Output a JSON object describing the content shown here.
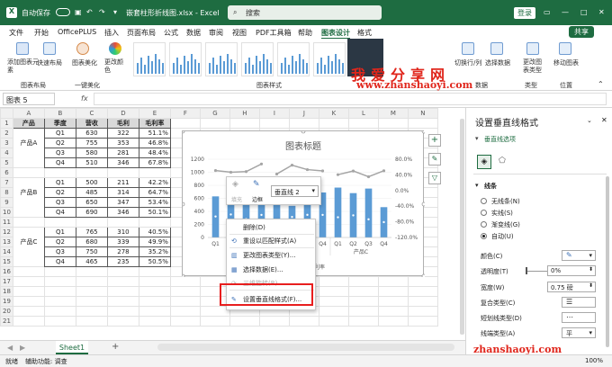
{
  "titlebar": {
    "autosave": "自动保存",
    "filename": "嵌套柱形折线图.xlsx - Excel",
    "search_placeholder": "搜索",
    "login": "登录",
    "color": "#1e6c41"
  },
  "menu": {
    "items": [
      "文件",
      "开始",
      "OfficePLUS",
      "插入",
      "页面布局",
      "公式",
      "数据",
      "审阅",
      "视图",
      "PDF工具箱",
      "帮助",
      "图表设计",
      "格式"
    ],
    "active": "图表设计",
    "share": "共享"
  },
  "ribbon": {
    "add_element": "添加图表元素",
    "quick_layout": "快速布局",
    "beautify": "图表美化",
    "change_colors": "更改颜色",
    "group_layout": "图表布局",
    "group_beautify": "一键美化",
    "group_styles": "图表样式",
    "switch_rowcol": "切换行/列",
    "select_data": "选择数据",
    "group_data": "数据",
    "change_type": "更改图表类型",
    "group_type": "类型",
    "move_chart": "移动图表",
    "group_location": "位置"
  },
  "watermark": {
    "line1": "我爱分享网",
    "line2": "www.zhanshaoyi.com",
    "line3": "zhanshaoyi.com"
  },
  "formulabar": {
    "namebox": "图表 5",
    "fx": "fx"
  },
  "sheet": {
    "columns": [
      "A",
      "B",
      "C",
      "D",
      "E",
      "F",
      "G",
      "H",
      "I",
      "J",
      "K",
      "L",
      "M",
      "N"
    ],
    "headers": [
      "产品",
      "季度",
      "营收",
      "毛利",
      "毛利率"
    ],
    "rows": [
      {
        "n": "2",
        "q": "Q1",
        "r": "630",
        "p": "322",
        "m": "51.1%"
      },
      {
        "n": "3",
        "g": "产品A",
        "q": "Q2",
        "r": "755",
        "p": "353",
        "m": "46.8%"
      },
      {
        "n": "4",
        "q": "Q3",
        "r": "580",
        "p": "281",
        "m": "48.4%"
      },
      {
        "n": "5",
        "q": "Q4",
        "r": "510",
        "p": "346",
        "m": "67.8%"
      },
      {
        "n": "6",
        "q": "",
        "r": "",
        "p": "",
        "m": ""
      },
      {
        "n": "7",
        "q": "Q1",
        "r": "500",
        "p": "211",
        "m": "42.2%"
      },
      {
        "n": "8",
        "g": "产品B",
        "q": "Q2",
        "r": "485",
        "p": "314",
        "m": "64.7%"
      },
      {
        "n": "9",
        "q": "Q3",
        "r": "650",
        "p": "347",
        "m": "53.4%"
      },
      {
        "n": "10",
        "q": "Q4",
        "r": "690",
        "p": "346",
        "m": "50.1%"
      },
      {
        "n": "11",
        "q": "",
        "r": "",
        "p": "",
        "m": ""
      },
      {
        "n": "12",
        "q": "Q1",
        "r": "765",
        "p": "310",
        "m": "40.5%"
      },
      {
        "n": "13",
        "g": "产品C",
        "q": "Q2",
        "r": "680",
        "p": "339",
        "m": "49.9%"
      },
      {
        "n": "14",
        "q": "Q3",
        "r": "750",
        "p": "278",
        "m": "35.2%"
      },
      {
        "n": "15",
        "q": "Q4",
        "r": "465",
        "p": "235",
        "m": "50.5%"
      },
      {
        "n": "16",
        "q": "",
        "r": "",
        "p": "",
        "m": ""
      },
      {
        "n": "17",
        "q": "",
        "r": "",
        "p": "",
        "m": ""
      },
      {
        "n": "18",
        "q": "",
        "r": "",
        "p": "",
        "m": ""
      },
      {
        "n": "19",
        "q": "",
        "r": "",
        "p": "",
        "m": ""
      },
      {
        "n": "20",
        "q": "",
        "r": "",
        "p": "",
        "m": ""
      },
      {
        "n": "21",
        "q": "",
        "r": "",
        "p": "",
        "m": ""
      }
    ]
  },
  "chart_data": {
    "type": "bar",
    "title": "图表标题",
    "categories": [
      "Q1",
      "Q2",
      "Q3",
      "Q4",
      "Q1",
      "Q2",
      "Q3",
      "Q4",
      "Q1",
      "Q2",
      "Q3",
      "Q4"
    ],
    "groups": [
      "产品A",
      "产品B",
      "产品C"
    ],
    "yticks": [
      "0",
      "200",
      "400",
      "600",
      "800",
      "1000",
      "1200"
    ],
    "y2ticks": [
      "-120.0%",
      "-80.0%",
      "-40.0%",
      "0.0%",
      "40.0%",
      "80.0%"
    ],
    "ylim": [
      0,
      1200
    ],
    "y2lim": [
      -1.2,
      0.8
    ],
    "series": [
      {
        "name": "营收",
        "values": [
          630,
          755,
          580,
          510,
          500,
          485,
          650,
          690,
          765,
          680,
          750,
          465
        ]
      },
      {
        "name": "毛利",
        "values": [
          322,
          353,
          281,
          346,
          211,
          314,
          347,
          346,
          310,
          339,
          278,
          235
        ]
      },
      {
        "name": "毛利率",
        "values": [
          0.511,
          0.468,
          0.484,
          0.678,
          0.422,
          0.647,
          0.534,
          0.501,
          0.405,
          0.499,
          0.352,
          0.505
        ]
      }
    ],
    "legend": "bottom",
    "bar_color": "#5b9bd5",
    "line_color": "#a5a5a5"
  },
  "minitoolbar": {
    "fill": "填充",
    "outline": "边框",
    "selector": "垂直线 2"
  },
  "contextmenu": {
    "items": [
      "删除(D)",
      "重设以匹配样式(A)",
      "更改图表类型(Y)...",
      "选择数据(E)...",
      "三维旋转(R)...",
      "设置垂直线格式(F)..."
    ],
    "highlighted": 5,
    "highlight_color": "#e81e1e"
  },
  "panel": {
    "title": "设置垂直线格式",
    "section": "垂直线选项",
    "line_header": "线条",
    "options": [
      "无线条(N)",
      "实线(S)",
      "渐变线(G)",
      "自动(U)"
    ],
    "selected": 3,
    "labels": [
      "颜色(C)",
      "透明度(T)",
      "宽度(W)",
      "复合类型(C)",
      "短划线类型(D)",
      "线端类型(A)",
      "连接类型(J)"
    ],
    "transparency": "0%",
    "width": "0.75 磅",
    "cap": "平"
  },
  "sheettabs": {
    "sheet": "Sheet1"
  },
  "statusbar": {
    "ready": "就绪",
    "accessibility": "辅助功能: 调查",
    "zoom": "100%"
  }
}
